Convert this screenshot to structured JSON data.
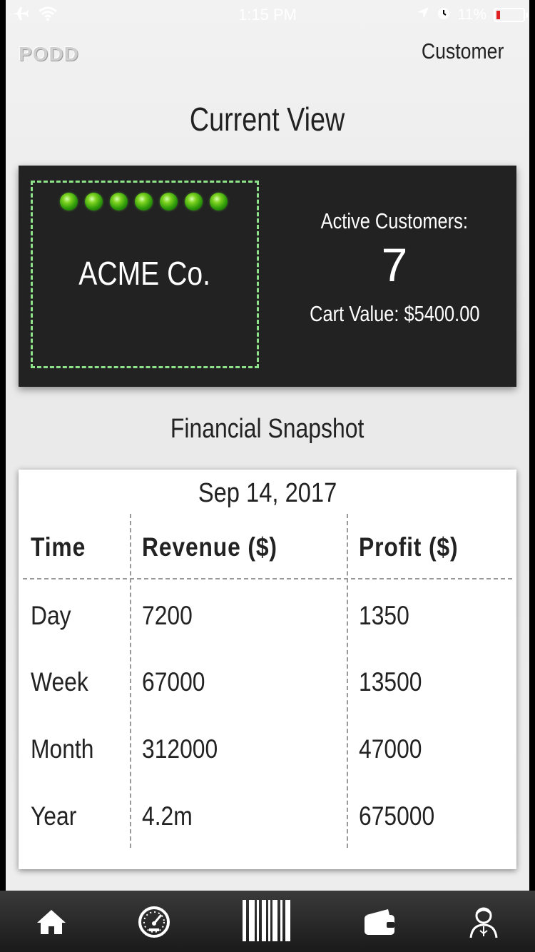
{
  "status_bar": {
    "time": "1:15 PM",
    "battery_percent": "11%",
    "icons": [
      "airplane-icon",
      "wifi-icon",
      "location-arrow-icon",
      "alarm-icon",
      "battery-icon"
    ]
  },
  "header": {
    "logo": "PODD",
    "customer_link": "Customer"
  },
  "page_title": "Current View",
  "current_view": {
    "company_name": "ACME Co.",
    "indicator_count": 7,
    "active_customers_label": "Active Customers:",
    "active_customers_value": "7",
    "cart_value_text": "Cart Value: $5400.00"
  },
  "financial": {
    "section_title": "Financial Snapshot",
    "date": "Sep 14, 2017",
    "headers": [
      "Time",
      "Revenue ($)",
      "Profit ($)"
    ],
    "rows": [
      [
        "Day",
        "7200",
        "1350"
      ],
      [
        "Week",
        "67000",
        "13500"
      ],
      [
        "Month",
        "312000",
        "47000"
      ],
      [
        "Year",
        "4.2m",
        "675000"
      ]
    ]
  },
  "bottom_nav": {
    "items": [
      "home-icon",
      "dashboard-gauge-icon",
      "barcode-scan-icon",
      "wallet-icon",
      "profile-icon"
    ]
  },
  "colors": {
    "panel_bg": "#222222",
    "indicator_green": "#2e9a0a",
    "dashed_border": "#8ee28a",
    "battery_low": "#e02020"
  }
}
